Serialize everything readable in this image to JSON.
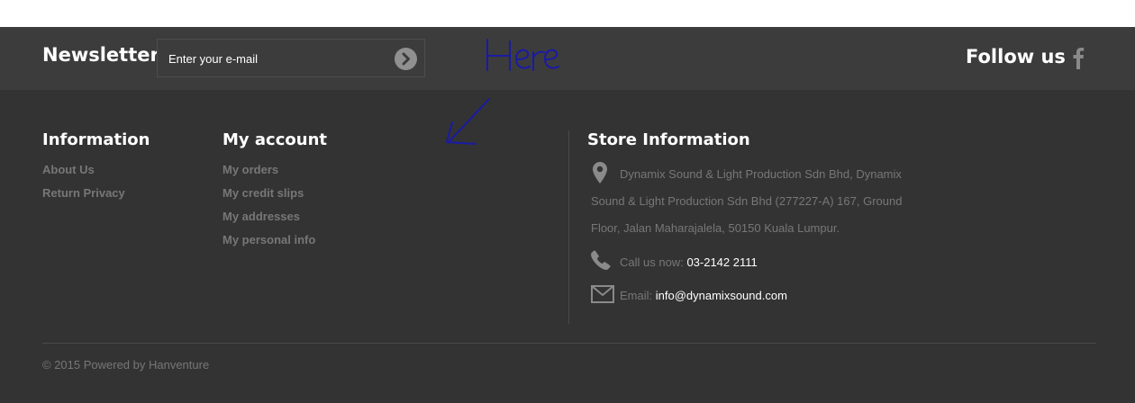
{
  "newsletter": {
    "title": "Newsletter",
    "placeholder": "Enter your e-mail",
    "submit_icon": "chevron-right-circle-icon"
  },
  "follow": {
    "title": "Follow us",
    "icon": "facebook-icon"
  },
  "annotation": {
    "text": "Here",
    "color": "#1a1aa6"
  },
  "information": {
    "title": "Information",
    "links": [
      "About Us",
      "Return Privacy"
    ]
  },
  "account": {
    "title": "My account",
    "links": [
      "My orders",
      "My credit slips",
      "My addresses",
      "My personal info"
    ]
  },
  "store": {
    "title": "Store Information",
    "address_lines": [
      "Dynamix Sound & Light Production Sdn Bhd, Dynamix",
      "Sound & Light Production Sdn Bhd (277227-A) 167, Ground",
      "Floor, Jalan Maharajalela, 50150 Kuala Lumpur."
    ],
    "phone_label": "Call us now:",
    "phone": "03-2142 2111",
    "email_label": "Email:",
    "email": "info@dynamixsound.com"
  },
  "copyright": "© 2015 Powered by Hanventure",
  "colors": {
    "footer_bg": "#333333",
    "topbar_bg": "#3c3c3c",
    "link": "#777777",
    "heading": "#ffffff"
  }
}
